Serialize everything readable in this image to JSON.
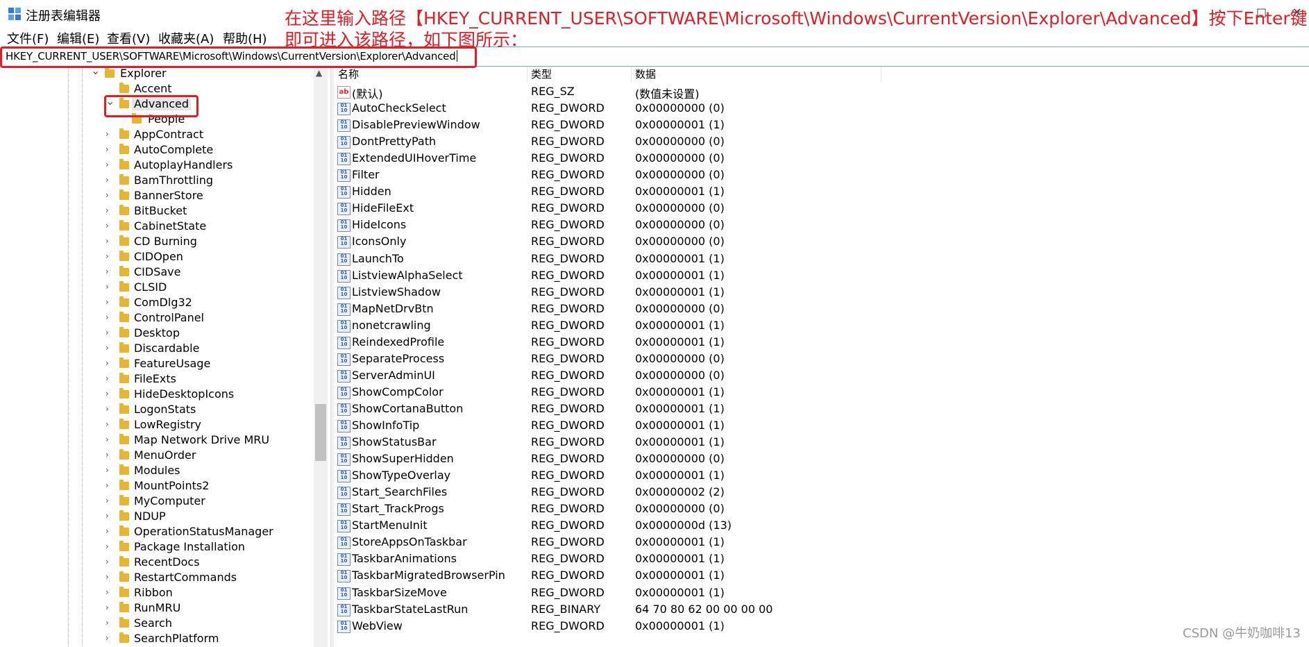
{
  "window": {
    "title": "注册表编辑器",
    "controls": [
      "–",
      "□",
      "✕"
    ]
  },
  "menu": [
    "文件(F)",
    "编辑(E)",
    "查看(V)",
    "收藏夹(A)",
    "帮助(H)"
  ],
  "address": {
    "path": "HKEY_CURRENT_USER\\SOFTWARE\\Microsoft\\Windows\\CurrentVersion\\Explorer\\Advanced"
  },
  "annotation": {
    "line1": "在这里输入路径【HKEY_CURRENT_USER\\SOFTWARE\\Microsoft\\Windows\\CurrentVersion\\Explorer\\Advanced】按下Enter键",
    "line2": "即可进入该路径，如下图所示："
  },
  "tree": {
    "items": [
      {
        "label": "Explorer",
        "expanded": true
      },
      {
        "label": "Accent",
        "expanded": false
      },
      {
        "label": "Advanced",
        "expanded": true,
        "selected": true
      },
      {
        "label": "People",
        "expanded": false
      },
      {
        "label": "AppContract",
        "expanded": false
      },
      {
        "label": "AutoComplete",
        "expanded": false
      },
      {
        "label": "AutoplayHandlers",
        "expanded": false
      },
      {
        "label": "BamThrottling",
        "expanded": false
      },
      {
        "label": "BannerStore",
        "expanded": false
      },
      {
        "label": "BitBucket",
        "expanded": false
      },
      {
        "label": "CabinetState",
        "expanded": false
      },
      {
        "label": "CD Burning",
        "expanded": false
      },
      {
        "label": "CIDOpen",
        "expanded": false
      },
      {
        "label": "CIDSave",
        "expanded": false
      },
      {
        "label": "CLSID",
        "expanded": false
      },
      {
        "label": "ComDlg32",
        "expanded": false
      },
      {
        "label": "ControlPanel",
        "expanded": false
      },
      {
        "label": "Desktop",
        "expanded": false
      },
      {
        "label": "Discardable",
        "expanded": false
      },
      {
        "label": "FeatureUsage",
        "expanded": false
      },
      {
        "label": "FileExts",
        "expanded": false
      },
      {
        "label": "HideDesktopIcons",
        "expanded": false
      },
      {
        "label": "LogonStats",
        "expanded": false
      },
      {
        "label": "LowRegistry",
        "expanded": false
      },
      {
        "label": "Map Network Drive MRU",
        "expanded": false
      },
      {
        "label": "MenuOrder",
        "expanded": false
      },
      {
        "label": "Modules",
        "expanded": false
      },
      {
        "label": "MountPoints2",
        "expanded": false
      },
      {
        "label": "MyComputer",
        "expanded": false
      },
      {
        "label": "NDUP",
        "expanded": false
      },
      {
        "label": "OperationStatusManager",
        "expanded": false
      },
      {
        "label": "Package Installation",
        "expanded": false
      },
      {
        "label": "RecentDocs",
        "expanded": false
      },
      {
        "label": "RestartCommands",
        "expanded": false
      },
      {
        "label": "Ribbon",
        "expanded": false
      },
      {
        "label": "RunMRU",
        "expanded": false
      },
      {
        "label": "Search",
        "expanded": false
      },
      {
        "label": "SearchPlatform",
        "expanded": false
      }
    ]
  },
  "list": {
    "columns": [
      "名称",
      "类型",
      "数据"
    ],
    "rows": [
      {
        "name": "(默认)",
        "type": "REG_SZ",
        "data": "(数值未设置)",
        "icon": "ab"
      },
      {
        "name": "AutoCheckSelect",
        "type": "REG_DWORD",
        "data": "0x00000000 (0)",
        "icon": "bin"
      },
      {
        "name": "DisablePreviewWindow",
        "type": "REG_DWORD",
        "data": "0x00000001 (1)",
        "icon": "bin"
      },
      {
        "name": "DontPrettyPath",
        "type": "REG_DWORD",
        "data": "0x00000000 (0)",
        "icon": "bin"
      },
      {
        "name": "ExtendedUIHoverTime",
        "type": "REG_DWORD",
        "data": "0x00000000 (0)",
        "icon": "bin"
      },
      {
        "name": "Filter",
        "type": "REG_DWORD",
        "data": "0x00000000 (0)",
        "icon": "bin"
      },
      {
        "name": "Hidden",
        "type": "REG_DWORD",
        "data": "0x00000001 (1)",
        "icon": "bin"
      },
      {
        "name": "HideFileExt",
        "type": "REG_DWORD",
        "data": "0x00000000 (0)",
        "icon": "bin"
      },
      {
        "name": "HideIcons",
        "type": "REG_DWORD",
        "data": "0x00000000 (0)",
        "icon": "bin"
      },
      {
        "name": "IconsOnly",
        "type": "REG_DWORD",
        "data": "0x00000000 (0)",
        "icon": "bin"
      },
      {
        "name": "LaunchTo",
        "type": "REG_DWORD",
        "data": "0x00000001 (1)",
        "icon": "bin"
      },
      {
        "name": "ListviewAlphaSelect",
        "type": "REG_DWORD",
        "data": "0x00000001 (1)",
        "icon": "bin"
      },
      {
        "name": "ListviewShadow",
        "type": "REG_DWORD",
        "data": "0x00000001 (1)",
        "icon": "bin"
      },
      {
        "name": "MapNetDrvBtn",
        "type": "REG_DWORD",
        "data": "0x00000000 (0)",
        "icon": "bin"
      },
      {
        "name": "nonetcrawling",
        "type": "REG_DWORD",
        "data": "0x00000001 (1)",
        "icon": "bin"
      },
      {
        "name": "ReindexedProfile",
        "type": "REG_DWORD",
        "data": "0x00000001 (1)",
        "icon": "bin"
      },
      {
        "name": "SeparateProcess",
        "type": "REG_DWORD",
        "data": "0x00000000 (0)",
        "icon": "bin"
      },
      {
        "name": "ServerAdminUI",
        "type": "REG_DWORD",
        "data": "0x00000000 (0)",
        "icon": "bin"
      },
      {
        "name": "ShowCompColor",
        "type": "REG_DWORD",
        "data": "0x00000001 (1)",
        "icon": "bin"
      },
      {
        "name": "ShowCortanaButton",
        "type": "REG_DWORD",
        "data": "0x00000001 (1)",
        "icon": "bin"
      },
      {
        "name": "ShowInfoTip",
        "type": "REG_DWORD",
        "data": "0x00000001 (1)",
        "icon": "bin"
      },
      {
        "name": "ShowStatusBar",
        "type": "REG_DWORD",
        "data": "0x00000001 (1)",
        "icon": "bin"
      },
      {
        "name": "ShowSuperHidden",
        "type": "REG_DWORD",
        "data": "0x00000000 (0)",
        "icon": "bin"
      },
      {
        "name": "ShowTypeOverlay",
        "type": "REG_DWORD",
        "data": "0x00000001 (1)",
        "icon": "bin"
      },
      {
        "name": "Start_SearchFiles",
        "type": "REG_DWORD",
        "data": "0x00000002 (2)",
        "icon": "bin"
      },
      {
        "name": "Start_TrackProgs",
        "type": "REG_DWORD",
        "data": "0x00000000 (0)",
        "icon": "bin"
      },
      {
        "name": "StartMenuInit",
        "type": "REG_DWORD",
        "data": "0x0000000d (13)",
        "icon": "bin"
      },
      {
        "name": "StoreAppsOnTaskbar",
        "type": "REG_DWORD",
        "data": "0x00000001 (1)",
        "icon": "bin"
      },
      {
        "name": "TaskbarAnimations",
        "type": "REG_DWORD",
        "data": "0x00000001 (1)",
        "icon": "bin"
      },
      {
        "name": "TaskbarMigratedBrowserPin",
        "type": "REG_DWORD",
        "data": "0x00000001 (1)",
        "icon": "bin"
      },
      {
        "name": "TaskbarSizeMove",
        "type": "REG_DWORD",
        "data": "0x00000001 (1)",
        "icon": "bin"
      },
      {
        "name": "TaskbarStateLastRun",
        "type": "REG_BINARY",
        "data": "64 70 80 62 00 00 00 00",
        "icon": "bin"
      },
      {
        "name": "WebView",
        "type": "REG_DWORD",
        "data": "0x00000001 (1)",
        "icon": "bin"
      }
    ]
  },
  "watermark": "CSDN @牛奶咖啡13",
  "colors": {
    "annotation": "#e51c23",
    "folder": "#e8b532"
  }
}
